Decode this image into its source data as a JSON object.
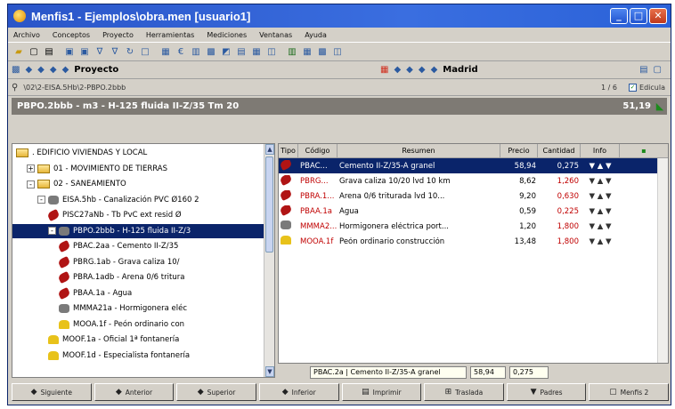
{
  "window": {
    "title": "Menfis1 - Ejemplos\\obra.men   [usuario1]",
    "minimize": "_",
    "maximize": "□",
    "close": "✕"
  },
  "menu": [
    "Archivo",
    "Conceptos",
    "Proyecto",
    "Herramientas",
    "Mediciones",
    "Ventanas",
    "Ayuda"
  ],
  "toolbar_icons": [
    "open-icon",
    "save-icon",
    "print-preview-icon",
    "copy-icon",
    "paste-icon",
    "cut-icon",
    "undo-icon",
    "redo-icon",
    "find-icon",
    "calc-icon",
    "chart-icon",
    "grid-icon",
    "settings-icon",
    "tree-icon",
    "list-icon",
    "excel-icon",
    "image-icon",
    "globe-icon",
    "window-icon"
  ],
  "nav": {
    "left_label": "Proyecto",
    "right_label": "Madrid"
  },
  "path": {
    "text": "\\02\\2-EISA.5Hb\\2-PBPO.2bbb",
    "counter": "1 / 6",
    "edit_label": "Edicula"
  },
  "header": {
    "title": "PBPO.2bbb - m3 - H-125 fluida II-Z/35 Tm 20",
    "price": "51,19"
  },
  "tree": [
    {
      "label": ". EDIFICIO VIVIENDAS Y LOCAL",
      "indent": 0,
      "icon": "folder",
      "exp": ""
    },
    {
      "label": "01 - MOVIMIENTO DE TIERRAS",
      "indent": 1,
      "icon": "folder",
      "exp": "+"
    },
    {
      "label": "02 - SANEAMIENTO",
      "indent": 1,
      "icon": "folder",
      "exp": "-"
    },
    {
      "label": "EISA.5hb - Canalización PVC Ø160 2",
      "indent": 2,
      "icon": "grey",
      "exp": "-"
    },
    {
      "label": "PISC27aNb - Tb PvC ext resid Ø",
      "indent": 3,
      "icon": "red",
      "exp": ""
    },
    {
      "label": "PBPO.2bbb - H-125 fluida II-Z/3",
      "indent": 3,
      "icon": "grey",
      "exp": "-",
      "selected": true
    },
    {
      "label": "PBAC.2aa - Cemento II-Z/35",
      "indent": 4,
      "icon": "red",
      "exp": ""
    },
    {
      "label": "PBRG.1ab - Grava caliza 10/",
      "indent": 4,
      "icon": "red",
      "exp": ""
    },
    {
      "label": "PBRA.1adb - Arena 0/6 tritura",
      "indent": 4,
      "icon": "red",
      "exp": ""
    },
    {
      "label": "PBAA.1a - Agua",
      "indent": 4,
      "icon": "red",
      "exp": ""
    },
    {
      "label": "MMMA21a - Hormigonera eléc",
      "indent": 4,
      "icon": "grey",
      "exp": ""
    },
    {
      "label": "MOOA.1f - Peón ordinario con",
      "indent": 4,
      "icon": "yel",
      "exp": ""
    },
    {
      "label": "MOOF.1a - Oficial 1ª fontanería",
      "indent": 3,
      "icon": "yel",
      "exp": ""
    },
    {
      "label": "MOOF.1d - Especialista fontanería",
      "indent": 3,
      "icon": "yel",
      "exp": ""
    }
  ],
  "table": {
    "columns": [
      "Tipo",
      "Código",
      "Resumen",
      "Precio",
      "Cantidad",
      "Info"
    ],
    "rows": [
      {
        "icon": "red",
        "code": "PBAC...",
        "summary": "Cemento II-Z/35-A granel",
        "price": "58,94",
        "qty": "0,275",
        "info": "▼ ▲ ▼",
        "selected": true
      },
      {
        "icon": "red",
        "code": "PBRG...",
        "summary": "Grava caliza 10/20 lvd 10 km",
        "price": "8,62",
        "qty": "1,260",
        "info": "▼ ▲ ▼"
      },
      {
        "icon": "red",
        "code": "PBRA.1...",
        "summary": "Arena 0/6 triturada lvd 10...",
        "price": "9,20",
        "qty": "0,630",
        "info": "▼ ▲ ▼"
      },
      {
        "icon": "red",
        "code": "PBAA.1a",
        "summary": "Agua",
        "price": "0,59",
        "qty": "0,225",
        "info": "▼ ▲ ▼"
      },
      {
        "icon": "grey",
        "code": "MMMA2...",
        "summary": "Hormigonera eléctrica port...",
        "price": "1,20",
        "qty": "1,800",
        "info": "▼ ▲ ▼"
      },
      {
        "icon": "yel",
        "code": "MOOA.1f",
        "summary": "Peón ordinario construcción",
        "price": "13,48",
        "qty": "1,800",
        "info": "▼ ▲ ▼"
      }
    ]
  },
  "status": {
    "text": "PBAC.2a | Cemento II-Z/35-A granel",
    "price": "58,94",
    "qty": "0,275"
  },
  "buttons": [
    {
      "label": "Siguiente",
      "icon": "◆"
    },
    {
      "label": "Anterior",
      "icon": "◆"
    },
    {
      "label": "Superior",
      "icon": "◆"
    },
    {
      "label": "Inferior",
      "icon": "◆"
    },
    {
      "label": "Imprimir",
      "icon": "▤"
    },
    {
      "label": "Traslada",
      "icon": "⊞"
    },
    {
      "label": "Padres",
      "icon": "▼"
    },
    {
      "label": "Menfis 2",
      "icon": "▢"
    }
  ]
}
